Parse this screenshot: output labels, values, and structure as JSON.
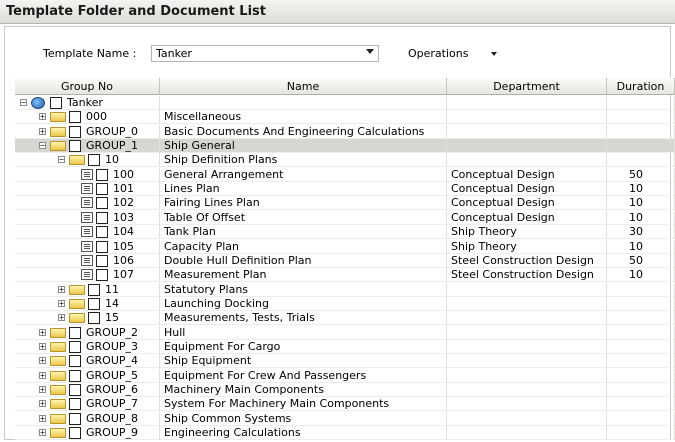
{
  "window": {
    "title": "Template Folder and Document List"
  },
  "toolbar": {
    "template_label": "Template Name :",
    "template_value": "Tanker",
    "operations_label": "Operations"
  },
  "columns": {
    "group": "Group No",
    "name": "Name",
    "department": "Department",
    "duration": "Duration"
  },
  "rows": [
    {
      "code": "Tanker",
      "name": "",
      "department": "",
      "duration": "",
      "level": 0,
      "kind": "root",
      "expand": "-"
    },
    {
      "code": "000",
      "name": "Miscellaneous",
      "department": "",
      "duration": "",
      "level": 1,
      "kind": "folder",
      "expand": "+"
    },
    {
      "code": "GROUP_0",
      "name": "Basic Documents And Engineering Calculations",
      "department": "",
      "duration": "",
      "level": 1,
      "kind": "folder",
      "expand": "+"
    },
    {
      "code": "GROUP_1",
      "name": "Ship General",
      "department": "",
      "duration": "",
      "level": 1,
      "kind": "folder",
      "expand": "-",
      "selected": true
    },
    {
      "code": "10",
      "name": "Ship Definition Plans",
      "department": "",
      "duration": "",
      "level": 2,
      "kind": "folder",
      "expand": "-"
    },
    {
      "code": "100",
      "name": "General Arrangement",
      "department": "Conceptual Design",
      "duration": "50",
      "level": 3,
      "kind": "doc"
    },
    {
      "code": "101",
      "name": "Lines Plan",
      "department": "Conceptual Design",
      "duration": "10",
      "level": 3,
      "kind": "doc"
    },
    {
      "code": "102",
      "name": "Fairing Lines Plan",
      "department": "Conceptual Design",
      "duration": "10",
      "level": 3,
      "kind": "doc"
    },
    {
      "code": "103",
      "name": "Table Of Offset",
      "department": "Conceptual Design",
      "duration": "10",
      "level": 3,
      "kind": "doc"
    },
    {
      "code": "104",
      "name": "Tank Plan",
      "department": "Ship Theory",
      "duration": "30",
      "level": 3,
      "kind": "doc"
    },
    {
      "code": "105",
      "name": "Capacity Plan",
      "department": "Ship Theory",
      "duration": "10",
      "level": 3,
      "kind": "doc"
    },
    {
      "code": "106",
      "name": "Double Hull Definition Plan",
      "department": "Steel Construction Design",
      "duration": "50",
      "level": 3,
      "kind": "doc"
    },
    {
      "code": "107",
      "name": "Measurement Plan",
      "department": "Steel Construction Design",
      "duration": "10",
      "level": 3,
      "kind": "doc"
    },
    {
      "code": "11",
      "name": "Statutory Plans",
      "department": "",
      "duration": "",
      "level": 2,
      "kind": "folder",
      "expand": "+"
    },
    {
      "code": "14",
      "name": "Launching Docking",
      "department": "",
      "duration": "",
      "level": 2,
      "kind": "folder",
      "expand": "+"
    },
    {
      "code": "15",
      "name": "Measurements, Tests, Trials",
      "department": "",
      "duration": "",
      "level": 2,
      "kind": "folder",
      "expand": "+"
    },
    {
      "code": "GROUP_2",
      "name": "Hull",
      "department": "",
      "duration": "",
      "level": 1,
      "kind": "folder",
      "expand": "+"
    },
    {
      "code": "GROUP_3",
      "name": "Equipment For Cargo",
      "department": "",
      "duration": "",
      "level": 1,
      "kind": "folder",
      "expand": "+"
    },
    {
      "code": "GROUP_4",
      "name": "Ship Equipment",
      "department": "",
      "duration": "",
      "level": 1,
      "kind": "folder",
      "expand": "+"
    },
    {
      "code": "GROUP_5",
      "name": "Equipment For Crew And Passengers",
      "department": "",
      "duration": "",
      "level": 1,
      "kind": "folder",
      "expand": "+"
    },
    {
      "code": "GROUP_6",
      "name": "Machinery Main Components",
      "department": "",
      "duration": "",
      "level": 1,
      "kind": "folder",
      "expand": "+"
    },
    {
      "code": "GROUP_7",
      "name": "System For Machinery Main Components",
      "department": "",
      "duration": "",
      "level": 1,
      "kind": "folder",
      "expand": "+"
    },
    {
      "code": "GROUP_8",
      "name": "Ship Common Systems",
      "department": "",
      "duration": "",
      "level": 1,
      "kind": "folder",
      "expand": "+"
    },
    {
      "code": "GROUP_9",
      "name": "Engineering Calculations",
      "department": "",
      "duration": "",
      "level": 1,
      "kind": "folder",
      "expand": "+"
    }
  ]
}
